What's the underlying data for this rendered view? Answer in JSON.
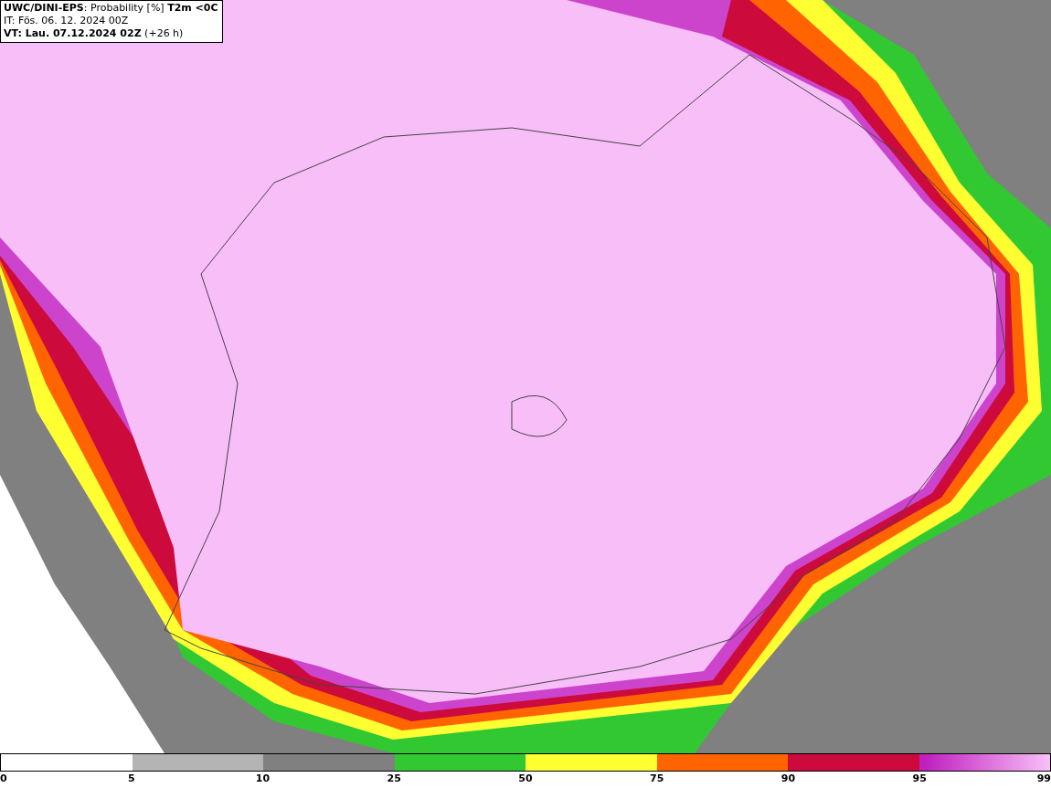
{
  "header": {
    "lines": [
      "**UWC/DINI-EPS**: Probability [%] **T2m <0C**",
      "IT: Fös. 06. 12. 2024 00Z",
      "**VT: Lau. 07.12.2024 02Z** (+26 h)"
    ]
  },
  "legend": {
    "segments": [
      {
        "kind": "solid",
        "color": "#ffffff"
      },
      {
        "kind": "solid",
        "color": "#b4b4b4"
      },
      {
        "kind": "solid",
        "color": "#808080"
      },
      {
        "kind": "solid",
        "color": "#32c832"
      },
      {
        "kind": "solid",
        "color": "#ffff32"
      },
      {
        "kind": "solid",
        "color": "#ff6400"
      },
      {
        "kind": "solid",
        "color": "#cc0a3c"
      },
      {
        "kind": "gradient",
        "color": "#c020c0"
      }
    ],
    "ticks": [
      "0",
      "5",
      "10",
      "25",
      "50",
      "75",
      "90",
      "95",
      "99"
    ]
  }
}
